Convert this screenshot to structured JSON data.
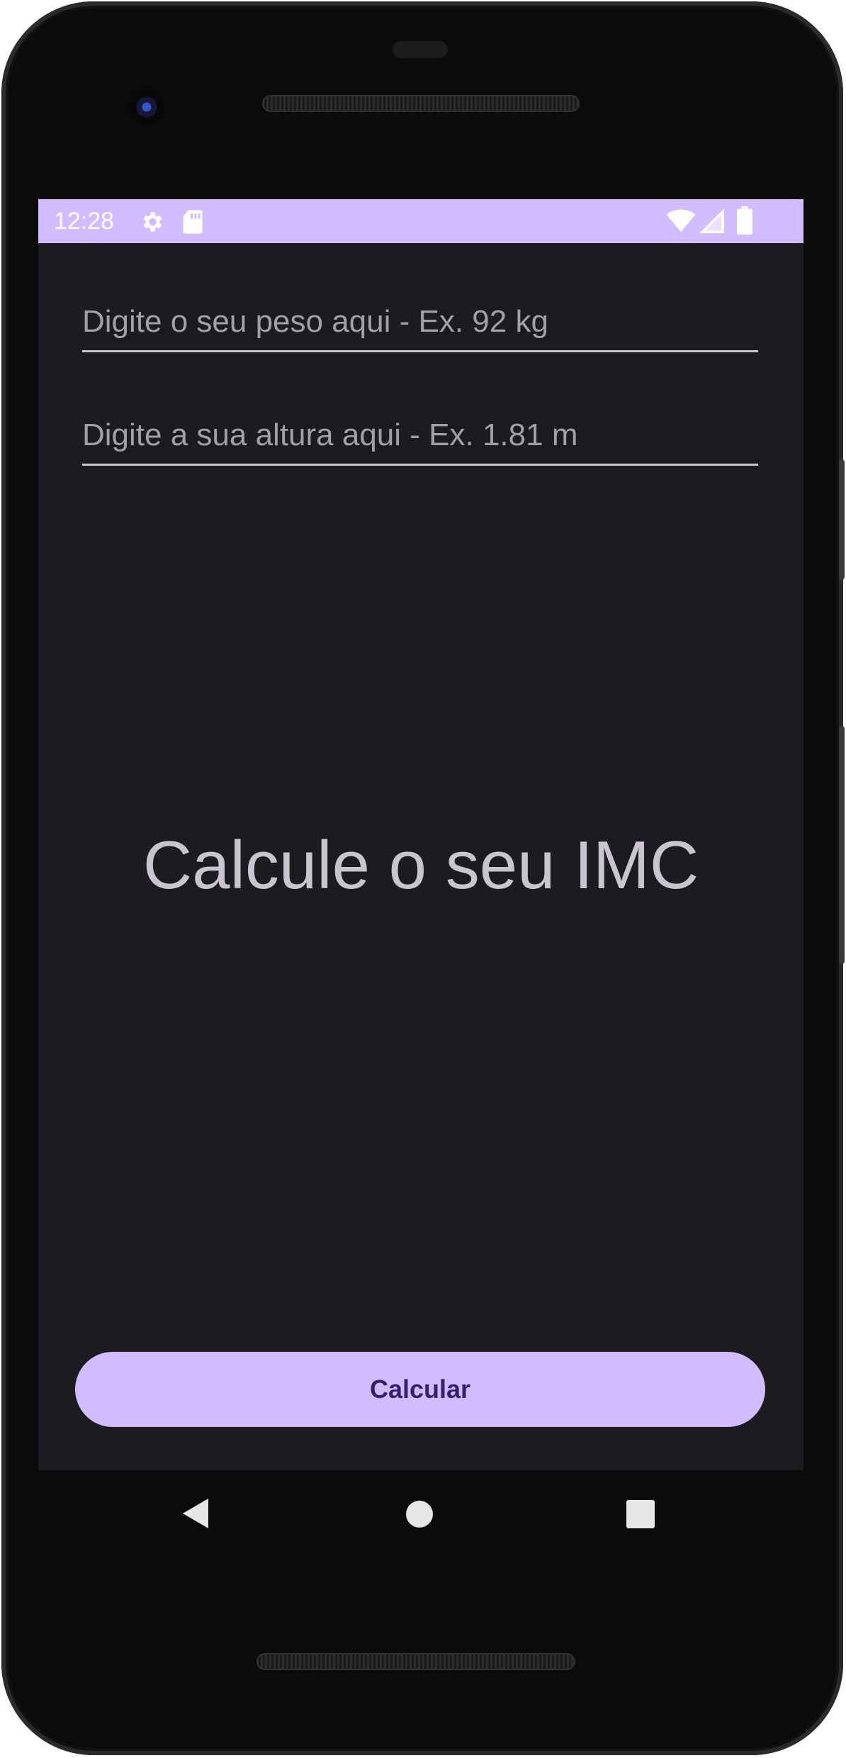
{
  "status_bar": {
    "time": "12:28",
    "icons": [
      "gear-icon",
      "sd-card-icon",
      "wifi-icon",
      "cell-signal-icon",
      "battery-icon"
    ],
    "background": "#d0bcff"
  },
  "form": {
    "weight_input": {
      "value": "",
      "placeholder": "Digite o seu peso aqui - Ex. 92 kg"
    },
    "height_input": {
      "value": "",
      "placeholder": "Digite a sua altura aqui - Ex. 1.81 m"
    }
  },
  "main": {
    "title": "Calcule o seu IMC"
  },
  "actions": {
    "calculate_label": "Calcular"
  },
  "nav_bar": {
    "icons": [
      "back-icon",
      "home-icon",
      "recents-icon"
    ]
  },
  "colors": {
    "accent": "#d0bcff",
    "background": "#1c1b1f",
    "button_text": "#381e72",
    "title_text": "#cac4d0"
  }
}
